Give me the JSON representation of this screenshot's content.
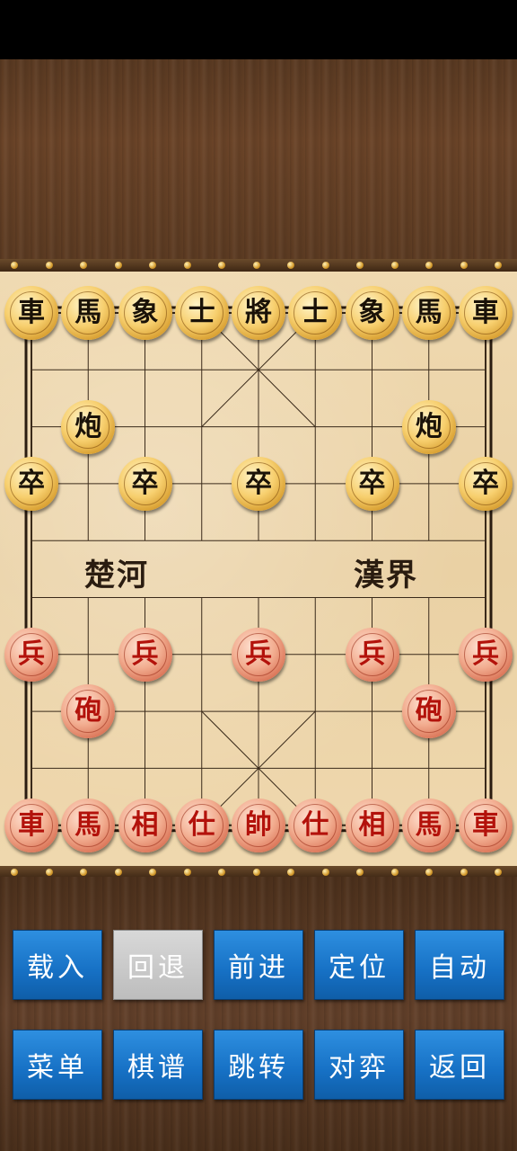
{
  "board": {
    "river_left": "楚河",
    "river_right": "漢界",
    "pieces": [
      {
        "side": "black",
        "label": "車",
        "file": 0,
        "rank": 0,
        "name": "black-chariot-left"
      },
      {
        "side": "black",
        "label": "馬",
        "file": 1,
        "rank": 0,
        "name": "black-horse-left"
      },
      {
        "side": "black",
        "label": "象",
        "file": 2,
        "rank": 0,
        "name": "black-elephant-left"
      },
      {
        "side": "black",
        "label": "士",
        "file": 3,
        "rank": 0,
        "name": "black-advisor-left"
      },
      {
        "side": "black",
        "label": "將",
        "file": 4,
        "rank": 0,
        "name": "black-general"
      },
      {
        "side": "black",
        "label": "士",
        "file": 5,
        "rank": 0,
        "name": "black-advisor-right"
      },
      {
        "side": "black",
        "label": "象",
        "file": 6,
        "rank": 0,
        "name": "black-elephant-right"
      },
      {
        "side": "black",
        "label": "馬",
        "file": 7,
        "rank": 0,
        "name": "black-horse-right"
      },
      {
        "side": "black",
        "label": "車",
        "file": 8,
        "rank": 0,
        "name": "black-chariot-right"
      },
      {
        "side": "black",
        "label": "炮",
        "file": 1,
        "rank": 2,
        "name": "black-cannon-left"
      },
      {
        "side": "black",
        "label": "炮",
        "file": 7,
        "rank": 2,
        "name": "black-cannon-right"
      },
      {
        "side": "black",
        "label": "卒",
        "file": 0,
        "rank": 3,
        "name": "black-soldier-1"
      },
      {
        "side": "black",
        "label": "卒",
        "file": 2,
        "rank": 3,
        "name": "black-soldier-2"
      },
      {
        "side": "black",
        "label": "卒",
        "file": 4,
        "rank": 3,
        "name": "black-soldier-3"
      },
      {
        "side": "black",
        "label": "卒",
        "file": 6,
        "rank": 3,
        "name": "black-soldier-4"
      },
      {
        "side": "black",
        "label": "卒",
        "file": 8,
        "rank": 3,
        "name": "black-soldier-5"
      },
      {
        "side": "red",
        "label": "兵",
        "file": 0,
        "rank": 6,
        "name": "red-soldier-1"
      },
      {
        "side": "red",
        "label": "兵",
        "file": 2,
        "rank": 6,
        "name": "red-soldier-2"
      },
      {
        "side": "red",
        "label": "兵",
        "file": 4,
        "rank": 6,
        "name": "red-soldier-3"
      },
      {
        "side": "red",
        "label": "兵",
        "file": 6,
        "rank": 6,
        "name": "red-soldier-4"
      },
      {
        "side": "red",
        "label": "兵",
        "file": 8,
        "rank": 6,
        "name": "red-soldier-5"
      },
      {
        "side": "red",
        "label": "砲",
        "file": 1,
        "rank": 7,
        "name": "red-cannon-left"
      },
      {
        "side": "red",
        "label": "砲",
        "file": 7,
        "rank": 7,
        "name": "red-cannon-right"
      },
      {
        "side": "red",
        "label": "車",
        "file": 0,
        "rank": 9,
        "name": "red-chariot-left"
      },
      {
        "side": "red",
        "label": "馬",
        "file": 1,
        "rank": 9,
        "name": "red-horse-left"
      },
      {
        "side": "red",
        "label": "相",
        "file": 2,
        "rank": 9,
        "name": "red-elephant-left"
      },
      {
        "side": "red",
        "label": "仕",
        "file": 3,
        "rank": 9,
        "name": "red-advisor-left"
      },
      {
        "side": "red",
        "label": "帥",
        "file": 4,
        "rank": 9,
        "name": "red-general"
      },
      {
        "side": "red",
        "label": "仕",
        "file": 5,
        "rank": 9,
        "name": "red-advisor-right"
      },
      {
        "side": "red",
        "label": "相",
        "file": 6,
        "rank": 9,
        "name": "red-elephant-right"
      },
      {
        "side": "red",
        "label": "馬",
        "file": 7,
        "rank": 9,
        "name": "red-horse-right"
      },
      {
        "side": "red",
        "label": "車",
        "file": 8,
        "rank": 9,
        "name": "red-chariot-right"
      }
    ]
  },
  "controls": {
    "row1": [
      {
        "label": "载入",
        "name": "load-button",
        "enabled": true
      },
      {
        "label": "回退",
        "name": "undo-button",
        "enabled": false
      },
      {
        "label": "前进",
        "name": "forward-button",
        "enabled": true
      },
      {
        "label": "定位",
        "name": "locate-button",
        "enabled": true
      },
      {
        "label": "自动",
        "name": "auto-button",
        "enabled": true
      }
    ],
    "row2": [
      {
        "label": "菜单",
        "name": "menu-button",
        "enabled": true
      },
      {
        "label": "棋谱",
        "name": "record-button",
        "enabled": true
      },
      {
        "label": "跳转",
        "name": "jump-button",
        "enabled": true
      },
      {
        "label": "对弈",
        "name": "play-button",
        "enabled": true
      },
      {
        "label": "返回",
        "name": "back-button",
        "enabled": true
      }
    ]
  },
  "colors": {
    "button_blue": "#1670c4",
    "button_disabled": "#c8c8c8",
    "red_piece_text": "#b3120b",
    "black_piece_text": "#1a1208"
  }
}
